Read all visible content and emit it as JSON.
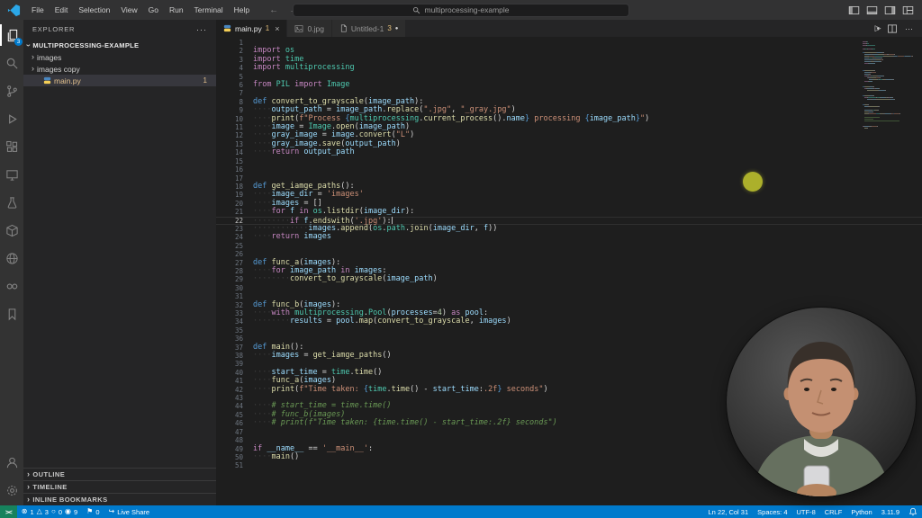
{
  "palette": {
    "k": "#c586c0",
    "d": "#569cd6",
    "f": "#dcdcaa",
    "c": "#4ec9b0",
    "v": "#9cdcfe",
    "s": "#ce9178",
    "n": "#b5cea8",
    "m": "#6a9955",
    "w": "#d4d4d4",
    "ws": "#3e3e3e"
  },
  "glyphs": {
    "back": "←",
    "forward": "→",
    "chevron": "›",
    "more": "···",
    "close": "×",
    "dirty": "●",
    "run": "▷",
    "caret_down": "▾",
    "error": "⊗",
    "warning": "△",
    "circle": "○",
    "target": "◉",
    "flag": "⚑",
    "share": "↪",
    "remote": "><"
  },
  "title_bar": {
    "menus": [
      "File",
      "Edit",
      "Selection",
      "View",
      "Go",
      "Run",
      "Terminal",
      "Help"
    ],
    "search_text": "multiprocessing-example"
  },
  "activity_bar": {
    "explorer_badge": "3",
    "icons": [
      "explorer",
      "search",
      "source-control",
      "run-debug",
      "extensions",
      "remote-explorer",
      "testing",
      "package",
      "live-share",
      "infinity",
      "bookmarks",
      "account",
      "settings"
    ]
  },
  "sidebar": {
    "title": "EXPLORER",
    "root": "MULTIPROCESSING-EXAMPLE",
    "items": [
      {
        "label": "images"
      },
      {
        "label": "images copy"
      },
      {
        "label": "main.py",
        "badge": "1"
      }
    ],
    "sections": [
      "OUTLINE",
      "TIMELINE",
      "INLINE BOOKMARKS"
    ]
  },
  "tabs": [
    {
      "label": "main.py",
      "badge": "1"
    },
    {
      "label": "0.jpg"
    },
    {
      "label": "Untitled-1",
      "badge": "3"
    }
  ],
  "editor": {
    "current_line": 22,
    "lines": [
      [],
      [
        [
          "k",
          "import"
        ],
        [
          "w",
          " "
        ],
        [
          "c",
          "os"
        ]
      ],
      [
        [
          "k",
          "import"
        ],
        [
          "w",
          " "
        ],
        [
          "c",
          "time"
        ]
      ],
      [
        [
          "k",
          "import"
        ],
        [
          "w",
          " "
        ],
        [
          "c",
          "multiprocessing"
        ]
      ],
      [],
      [
        [
          "k",
          "from"
        ],
        [
          "w",
          " "
        ],
        [
          "c",
          "PIL"
        ],
        [
          "w",
          " "
        ],
        [
          "k",
          "import"
        ],
        [
          "w",
          " "
        ],
        [
          "c",
          "Image"
        ]
      ],
      [],
      [
        [
          "d",
          "def"
        ],
        [
          "w",
          " "
        ],
        [
          "f",
          "convert_to_grayscale"
        ],
        [
          "w",
          "("
        ],
        [
          "v",
          "image_path"
        ],
        [
          "w",
          "):"
        ]
      ],
      [
        [
          "ws",
          "····"
        ],
        [
          "v",
          "output_path"
        ],
        [
          "w",
          " = "
        ],
        [
          "v",
          "image_path"
        ],
        [
          "w",
          "."
        ],
        [
          "f",
          "replace"
        ],
        [
          "w",
          "("
        ],
        [
          "s",
          "\".jpg\""
        ],
        [
          "w",
          ", "
        ],
        [
          "s",
          "\"_gray.jpg\""
        ],
        [
          "w",
          ")"
        ]
      ],
      [
        [
          "ws",
          "····"
        ],
        [
          "f",
          "print"
        ],
        [
          "w",
          "("
        ],
        [
          "s",
          "f\"Process "
        ],
        [
          "d",
          "{"
        ],
        [
          "c",
          "multiprocessing"
        ],
        [
          "w",
          "."
        ],
        [
          "f",
          "current_process"
        ],
        [
          "w",
          "()."
        ],
        [
          "v",
          "name"
        ],
        [
          "d",
          "}"
        ],
        [
          "s",
          " processing "
        ],
        [
          "d",
          "{"
        ],
        [
          "v",
          "image_path"
        ],
        [
          "d",
          "}"
        ],
        [
          "s",
          "\""
        ],
        [
          "w",
          ")"
        ]
      ],
      [
        [
          "ws",
          "····"
        ],
        [
          "v",
          "image"
        ],
        [
          "w",
          " = "
        ],
        [
          "c",
          "Image"
        ],
        [
          "w",
          "."
        ],
        [
          "f",
          "open"
        ],
        [
          "w",
          "("
        ],
        [
          "v",
          "image_path"
        ],
        [
          "w",
          ")"
        ]
      ],
      [
        [
          "ws",
          "····"
        ],
        [
          "v",
          "gray_image"
        ],
        [
          "w",
          " = "
        ],
        [
          "v",
          "image"
        ],
        [
          "w",
          "."
        ],
        [
          "f",
          "convert"
        ],
        [
          "w",
          "("
        ],
        [
          "s",
          "\"L\""
        ],
        [
          "w",
          ")"
        ]
      ],
      [
        [
          "ws",
          "····"
        ],
        [
          "v",
          "gray_image"
        ],
        [
          "w",
          "."
        ],
        [
          "f",
          "save"
        ],
        [
          "w",
          "("
        ],
        [
          "v",
          "output_path"
        ],
        [
          "w",
          ")"
        ]
      ],
      [
        [
          "ws",
          "····"
        ],
        [
          "k",
          "return"
        ],
        [
          "w",
          " "
        ],
        [
          "v",
          "output_path"
        ]
      ],
      [],
      [],
      [],
      [
        [
          "d",
          "def"
        ],
        [
          "w",
          " "
        ],
        [
          "f",
          "get_iamge_paths"
        ],
        [
          "w",
          "():"
        ]
      ],
      [
        [
          "ws",
          "····"
        ],
        [
          "v",
          "image_dir"
        ],
        [
          "w",
          " = "
        ],
        [
          "s",
          "'images'"
        ]
      ],
      [
        [
          "ws",
          "····"
        ],
        [
          "v",
          "images"
        ],
        [
          "w",
          " = []"
        ]
      ],
      [
        [
          "ws",
          "····"
        ],
        [
          "k",
          "for"
        ],
        [
          "w",
          " "
        ],
        [
          "v",
          "f"
        ],
        [
          "w",
          " "
        ],
        [
          "k",
          "in"
        ],
        [
          "w",
          " "
        ],
        [
          "c",
          "os"
        ],
        [
          "w",
          "."
        ],
        [
          "f",
          "listdir"
        ],
        [
          "w",
          "("
        ],
        [
          "v",
          "image_dir"
        ],
        [
          "w",
          "):"
        ]
      ],
      [
        [
          "ws",
          "········"
        ],
        [
          "k",
          "if"
        ],
        [
          "w",
          " "
        ],
        [
          "v",
          "f"
        ],
        [
          "w",
          "."
        ],
        [
          "f",
          "endswith"
        ],
        [
          "w",
          "("
        ],
        [
          "s",
          "'.jpg'"
        ],
        [
          "w",
          "):"
        ]
      ],
      [
        [
          "ws",
          "············"
        ],
        [
          "v",
          "images"
        ],
        [
          "w",
          "."
        ],
        [
          "f",
          "append"
        ],
        [
          "w",
          "("
        ],
        [
          "c",
          "os"
        ],
        [
          "w",
          "."
        ],
        [
          "c",
          "path"
        ],
        [
          "w",
          "."
        ],
        [
          "f",
          "join"
        ],
        [
          "w",
          "("
        ],
        [
          "v",
          "image_dir"
        ],
        [
          "w",
          ", "
        ],
        [
          "v",
          "f"
        ],
        [
          "w",
          "))"
        ]
      ],
      [
        [
          "ws",
          "····"
        ],
        [
          "k",
          "return"
        ],
        [
          "w",
          " "
        ],
        [
          "v",
          "images"
        ]
      ],
      [],
      [],
      [
        [
          "d",
          "def"
        ],
        [
          "w",
          " "
        ],
        [
          "f",
          "func_a"
        ],
        [
          "w",
          "("
        ],
        [
          "v",
          "images"
        ],
        [
          "w",
          "):"
        ]
      ],
      [
        [
          "ws",
          "····"
        ],
        [
          "k",
          "for"
        ],
        [
          "w",
          " "
        ],
        [
          "v",
          "image_path"
        ],
        [
          "w",
          " "
        ],
        [
          "k",
          "in"
        ],
        [
          "w",
          " "
        ],
        [
          "v",
          "images"
        ],
        [
          "w",
          ":"
        ]
      ],
      [
        [
          "ws",
          "········"
        ],
        [
          "f",
          "convert_to_grayscale"
        ],
        [
          "w",
          "("
        ],
        [
          "v",
          "image_path"
        ],
        [
          "w",
          ")"
        ]
      ],
      [],
      [],
      [
        [
          "d",
          "def"
        ],
        [
          "w",
          " "
        ],
        [
          "f",
          "func_b"
        ],
        [
          "w",
          "("
        ],
        [
          "v",
          "images"
        ],
        [
          "w",
          "):"
        ]
      ],
      [
        [
          "ws",
          "····"
        ],
        [
          "k",
          "with"
        ],
        [
          "w",
          " "
        ],
        [
          "c",
          "multiprocessing"
        ],
        [
          "w",
          "."
        ],
        [
          "c",
          "Pool"
        ],
        [
          "w",
          "("
        ],
        [
          "v",
          "processes"
        ],
        [
          "w",
          "="
        ],
        [
          "n",
          "4"
        ],
        [
          "w",
          ") "
        ],
        [
          "k",
          "as"
        ],
        [
          "w",
          " "
        ],
        [
          "v",
          "pool"
        ],
        [
          "w",
          ":"
        ]
      ],
      [
        [
          "ws",
          "········"
        ],
        [
          "v",
          "results"
        ],
        [
          "w",
          " = "
        ],
        [
          "v",
          "pool"
        ],
        [
          "w",
          "."
        ],
        [
          "f",
          "map"
        ],
        [
          "w",
          "("
        ],
        [
          "f",
          "convert_to_grayscale"
        ],
        [
          "w",
          ", "
        ],
        [
          "v",
          "images"
        ],
        [
          "w",
          ")"
        ]
      ],
      [],
      [],
      [
        [
          "d",
          "def"
        ],
        [
          "w",
          " "
        ],
        [
          "f",
          "main"
        ],
        [
          "w",
          "():"
        ]
      ],
      [
        [
          "ws",
          "····"
        ],
        [
          "v",
          "images"
        ],
        [
          "w",
          " = "
        ],
        [
          "f",
          "get_iamge_paths"
        ],
        [
          "w",
          "()"
        ]
      ],
      [],
      [
        [
          "ws",
          "····"
        ],
        [
          "v",
          "start_time"
        ],
        [
          "w",
          " = "
        ],
        [
          "c",
          "time"
        ],
        [
          "w",
          "."
        ],
        [
          "f",
          "time"
        ],
        [
          "w",
          "()"
        ]
      ],
      [
        [
          "ws",
          "····"
        ],
        [
          "f",
          "func_a"
        ],
        [
          "w",
          "("
        ],
        [
          "v",
          "images"
        ],
        [
          "w",
          ")"
        ]
      ],
      [
        [
          "ws",
          "····"
        ],
        [
          "f",
          "print"
        ],
        [
          "w",
          "("
        ],
        [
          "s",
          "f\"Time taken: "
        ],
        [
          "d",
          "{"
        ],
        [
          "c",
          "time"
        ],
        [
          "w",
          "."
        ],
        [
          "f",
          "time"
        ],
        [
          "w",
          "() - "
        ],
        [
          "v",
          "start_time"
        ],
        [
          "w",
          ":"
        ],
        [
          "s",
          ".2f"
        ],
        [
          "d",
          "}"
        ],
        [
          "s",
          " seconds\""
        ],
        [
          "w",
          ")"
        ]
      ],
      [],
      [
        [
          "ws",
          "····"
        ],
        [
          "m",
          "# start_time = time.time()"
        ]
      ],
      [
        [
          "ws",
          "····"
        ],
        [
          "m",
          "# func_b(images)"
        ]
      ],
      [
        [
          "ws",
          "····"
        ],
        [
          "m",
          "# print(f\"Time taken: {time.time() - start_time:.2f} seconds\")"
        ]
      ],
      [],
      [],
      [
        [
          "k",
          "if"
        ],
        [
          "w",
          " "
        ],
        [
          "v",
          "__name__"
        ],
        [
          "w",
          " == "
        ],
        [
          "s",
          "'__main__'"
        ],
        [
          "w",
          ":"
        ]
      ],
      [
        [
          "ws",
          "····"
        ],
        [
          "f",
          "main"
        ],
        [
          "w",
          "()"
        ]
      ],
      []
    ]
  },
  "status_bar": {
    "errors": "1",
    "warnings": "3",
    "count_a": "0",
    "count_b": "9",
    "bookmarks": "0",
    "live_share": "Live Share",
    "line_col": "Ln 22, Col 31",
    "spaces": "Spaces: 4",
    "encoding": "UTF-8",
    "eol": "CRLF",
    "language": "Python",
    "version": "3.11.9"
  }
}
